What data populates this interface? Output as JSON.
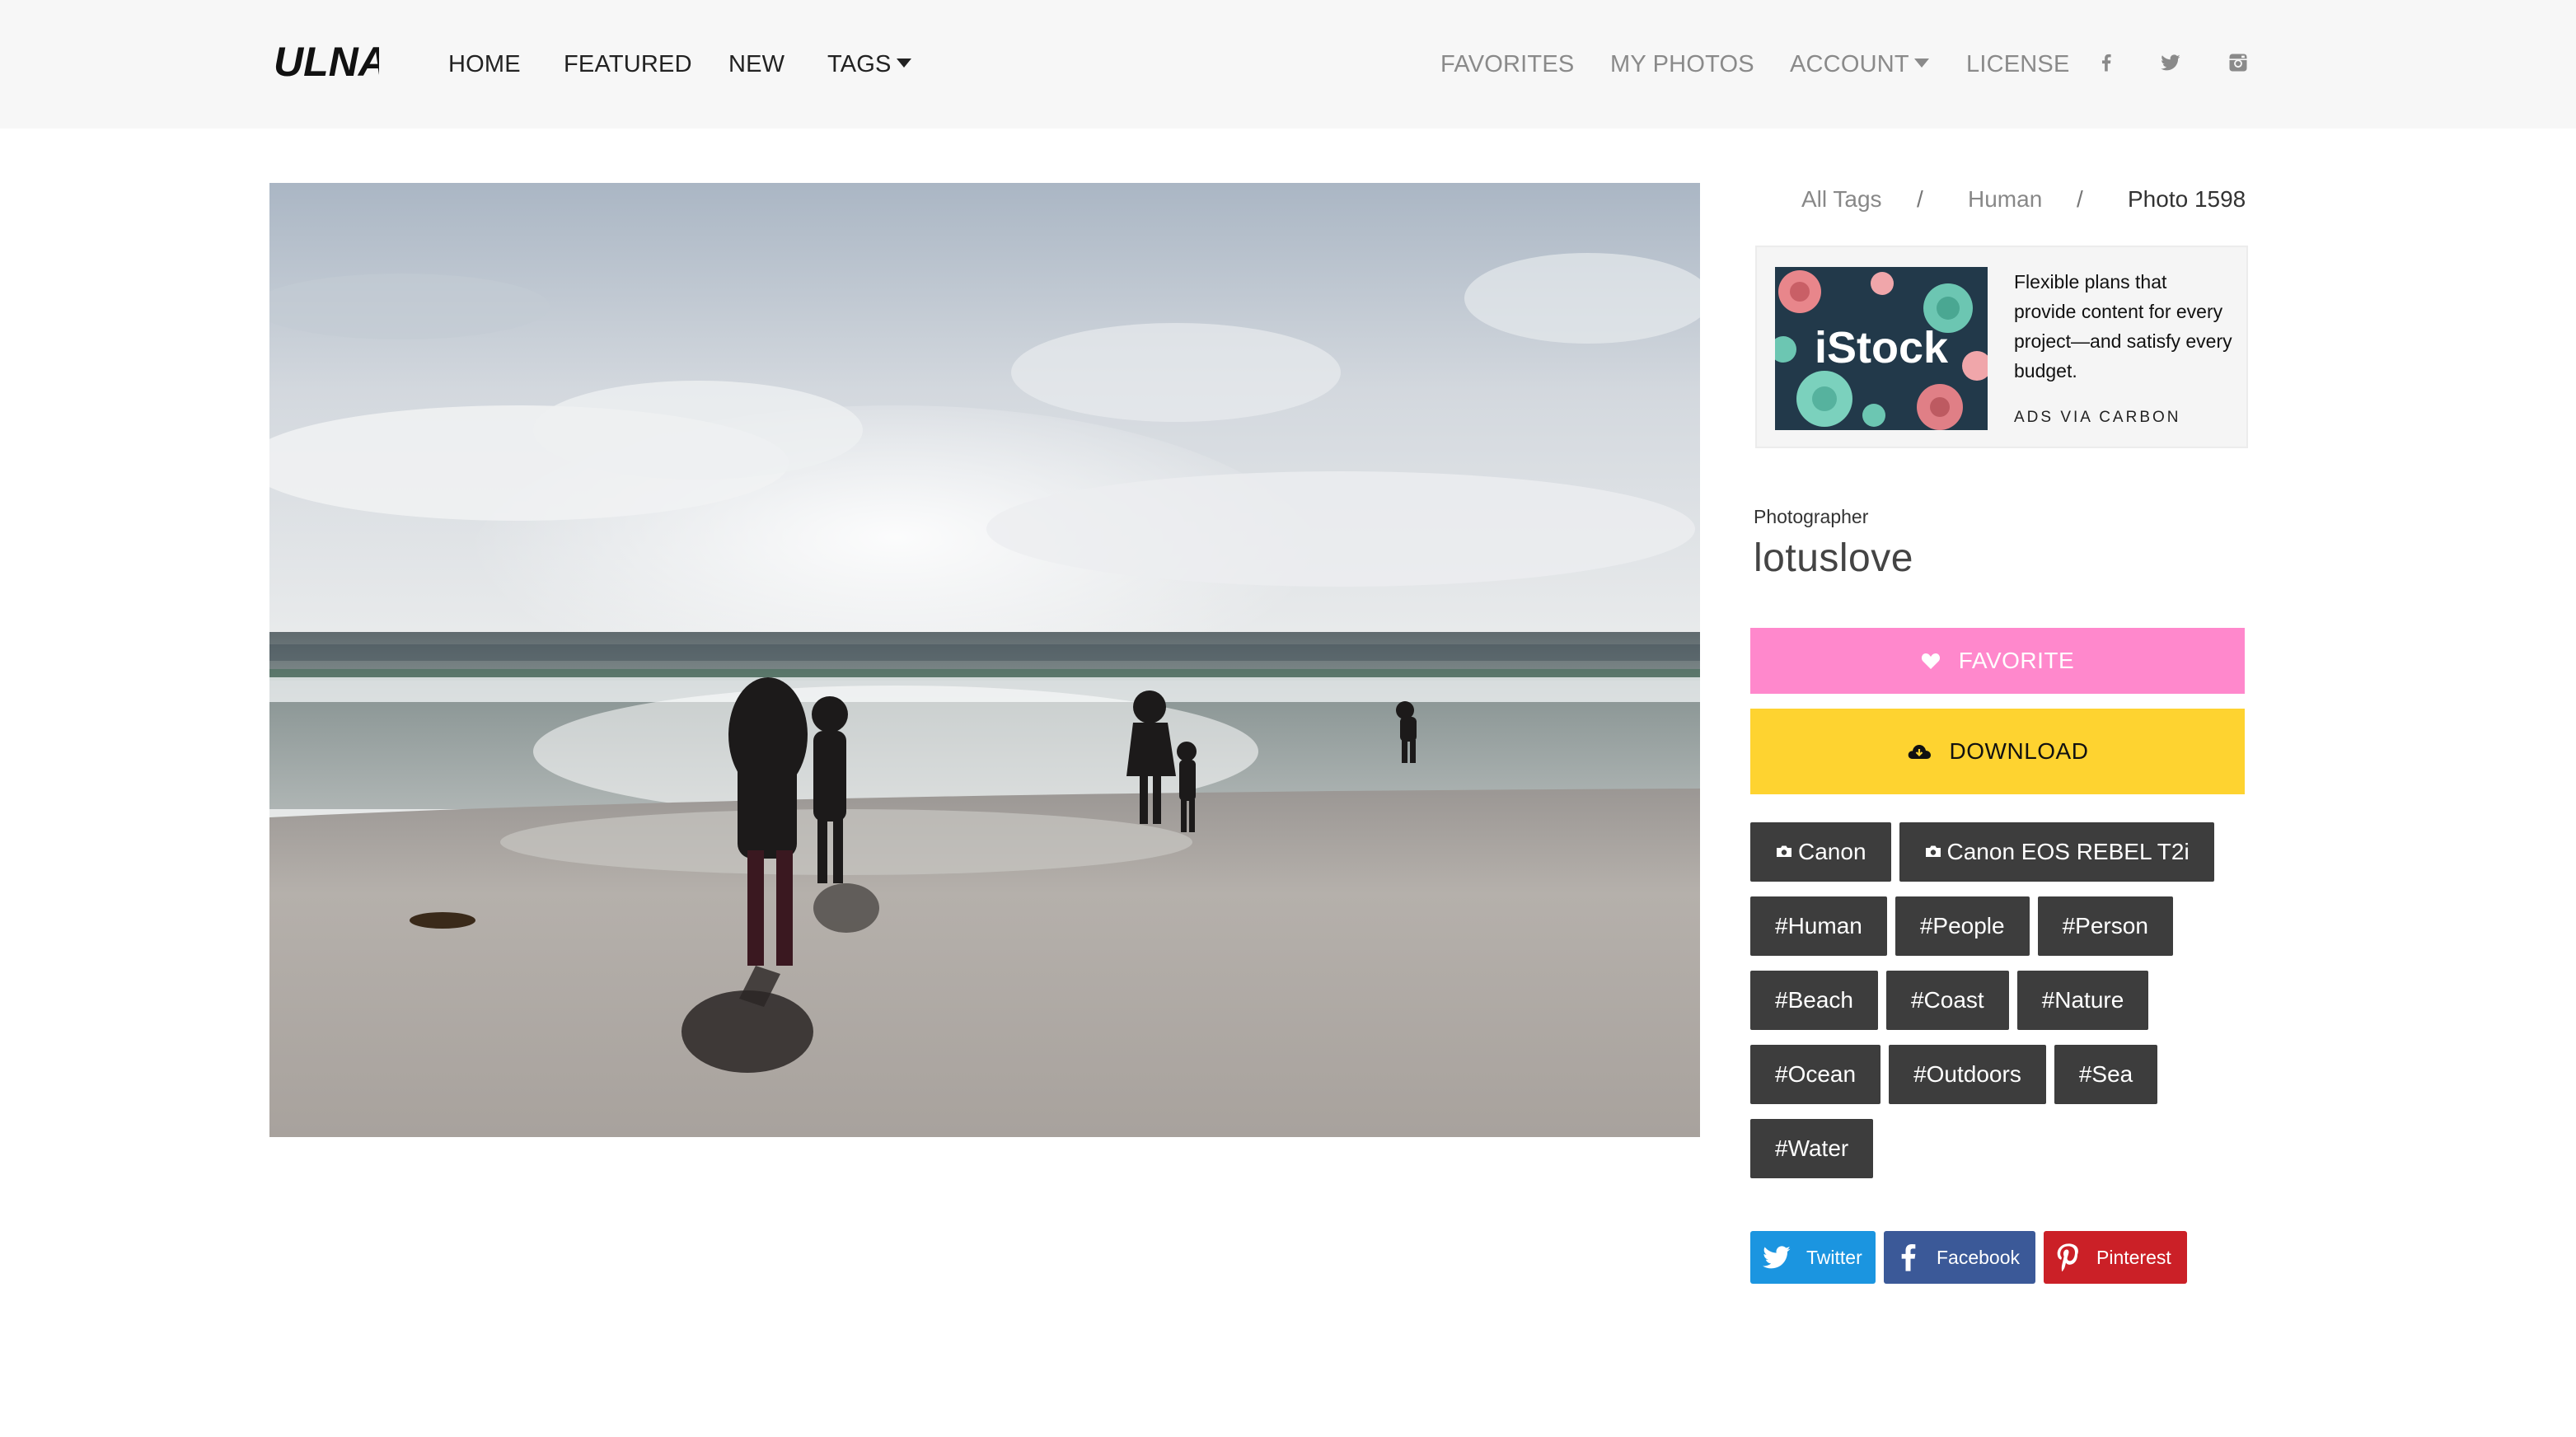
{
  "nav": {
    "logo": "ULNA",
    "left": [
      "HOME",
      "FEATURED",
      "NEW",
      "TAGS"
    ],
    "right": [
      "FAVORITES",
      "MY PHOTOS",
      "ACCOUNT",
      "LICENSE"
    ],
    "social_icons": [
      "facebook-icon",
      "twitter-icon",
      "instagram-icon"
    ]
  },
  "photo": {
    "description_icon": "beach-silhouette-photo"
  },
  "breadcrumb": {
    "items": [
      "All Tags",
      "Human",
      "Photo 1598"
    ],
    "separator": "/"
  },
  "ad": {
    "brand": "iStock",
    "text": "Flexible plans that provide content for every project—and satisfy every budget.",
    "via": "ADS VIA CARBON"
  },
  "photographer": {
    "label": "Photographer",
    "name": "lotuslove"
  },
  "actions": {
    "favorite": "FAVORITE",
    "download": "DOWNLOAD"
  },
  "camera_tags": [
    "Canon",
    "Canon EOS REBEL T2i"
  ],
  "tags": [
    "#Human",
    "#People",
    "#Person",
    "#Beach",
    "#Coast",
    "#Nature",
    "#Ocean",
    "#Outdoors",
    "#Sea",
    "#Water"
  ],
  "share": {
    "twitter": "Twitter",
    "facebook": "Facebook",
    "pinterest": "Pinterest"
  },
  "colors": {
    "nav_bg": "#f7f7f7",
    "favorite": "#ff88cc",
    "download": "#fed330",
    "tag_bg": "#3d3d3d",
    "twitter": "#1b95e0",
    "facebook": "#3b5998",
    "pinterest": "#cb2027"
  }
}
